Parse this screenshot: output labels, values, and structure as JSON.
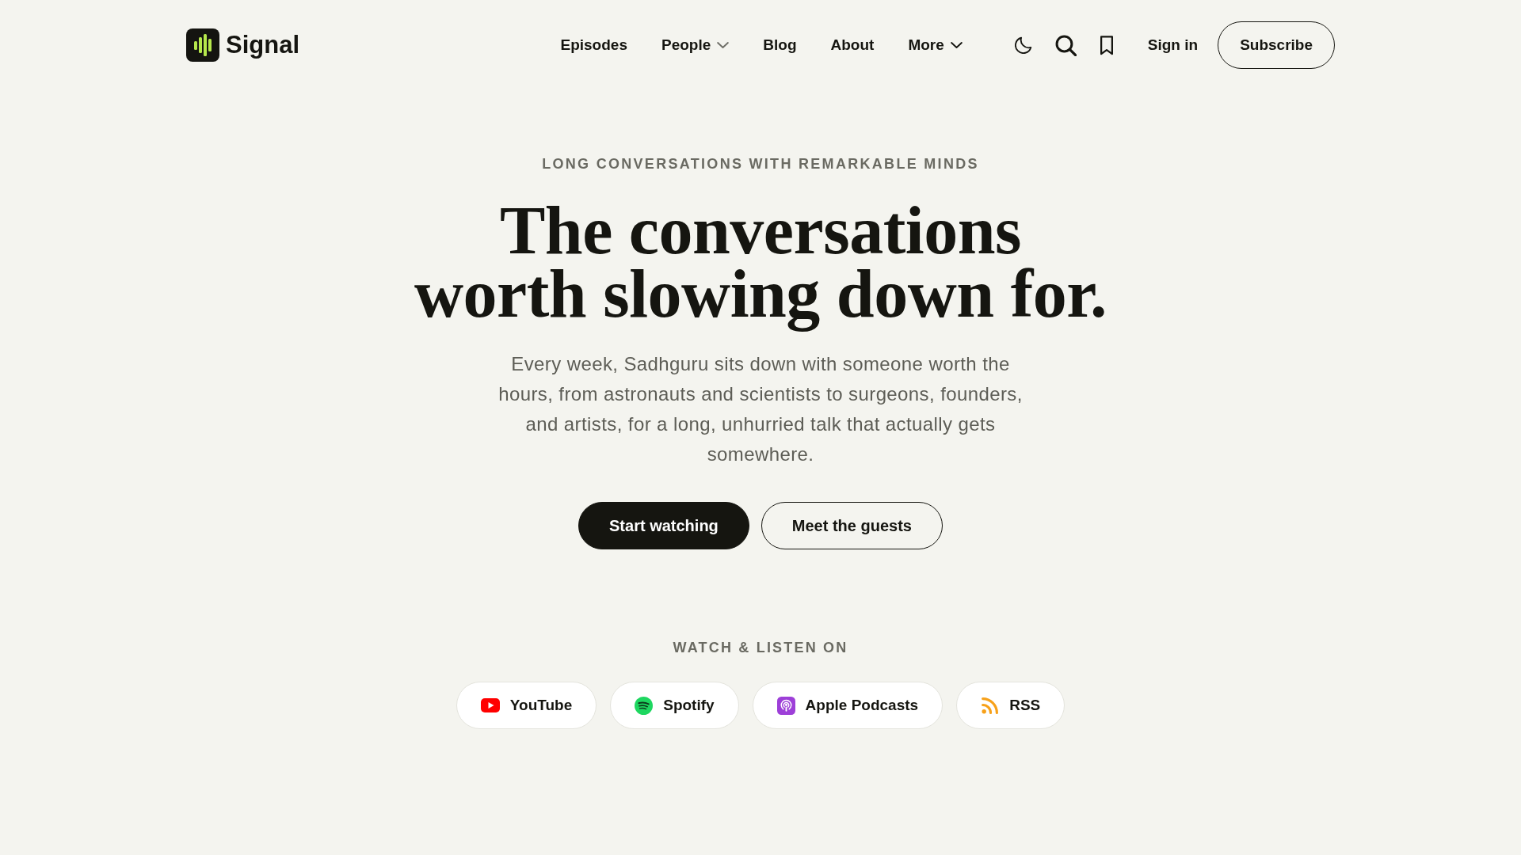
{
  "header": {
    "brand": "Signal",
    "nav": [
      {
        "label": "Episodes",
        "menu": false
      },
      {
        "label": "People",
        "menu": true
      },
      {
        "label": "Blog",
        "menu": false
      },
      {
        "label": "About",
        "menu": false
      },
      {
        "label": "More",
        "menu": true
      }
    ],
    "sign_in": "Sign in",
    "subscribe": "Subscribe"
  },
  "hero": {
    "eyebrow": "LONG CONVERSATIONS WITH REMARKABLE MINDS",
    "title_lines": [
      "The conversations",
      "worth slowing down for."
    ],
    "description": "Every week, Sadhguru sits down with someone worth the hours, from astronauts and scientists to surgeons, founders, and artists, for a long, unhurried talk that actually gets somewhere.",
    "actions": [
      {
        "label": "Start watching",
        "kind": "primary"
      },
      {
        "label": "Meet the guests",
        "kind": "secondary"
      }
    ]
  },
  "platforms": {
    "heading": "WATCH & LISTEN ON",
    "items": [
      {
        "label": "YouTube",
        "kind": "youtube"
      },
      {
        "label": "Spotify",
        "kind": "spotify"
      },
      {
        "label": "Apple Podcasts",
        "kind": "podcasts"
      },
      {
        "label": "RSS",
        "kind": "rss"
      }
    ]
  }
}
